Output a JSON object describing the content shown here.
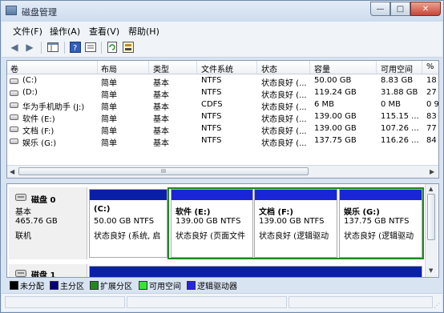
{
  "window": {
    "title": "磁盘管理",
    "min_label": "—",
    "max_label": "□",
    "close_label": "✕"
  },
  "menu": [
    "文件(F)",
    "操作(A)",
    "查看(V)",
    "帮助(H)"
  ],
  "columns": [
    "卷",
    "布局",
    "类型",
    "文件系统",
    "状态",
    "容量",
    "可用空间",
    "%"
  ],
  "volumes": [
    [
      "(C:)",
      "简单",
      "基本",
      "NTFS",
      "状态良好 (...",
      "50.00 GB",
      "8.83 GB",
      "18"
    ],
    [
      "(D:)",
      "简单",
      "基本",
      "NTFS",
      "状态良好 (...",
      "119.24 GB",
      "31.88 GB",
      "27"
    ],
    [
      "华为手机助手 (J:)",
      "简单",
      "基本",
      "CDFS",
      "状态良好 (...",
      "6 MB",
      "0 MB",
      "0 9"
    ],
    [
      "软件 (E:)",
      "简单",
      "基本",
      "NTFS",
      "状态良好 (...",
      "139.00 GB",
      "115.15 ...",
      "83"
    ],
    [
      "文档 (F:)",
      "简单",
      "基本",
      "NTFS",
      "状态良好 (...",
      "139.00 GB",
      "107.26 ...",
      "77"
    ],
    [
      "娱乐 (G:)",
      "简单",
      "基本",
      "NTFS",
      "状态良好 (...",
      "137.75 GB",
      "116.26 ...",
      "84"
    ]
  ],
  "hscroll_grip": "III",
  "disk0": {
    "name": "磁盘 0",
    "type": "基本",
    "size": "465.76 GB",
    "status": "联机",
    "partitions": [
      {
        "name": "(C:)",
        "size": "50.00 GB NTFS",
        "status": "状态良好 (系统, 启"
      },
      {
        "name": "软件  (E:)",
        "size": "139.00 GB NTFS",
        "status": "状态良好 (页面文件"
      },
      {
        "name": "文档  (F:)",
        "size": "139.00 GB NTFS",
        "status": "状态良好 (逻辑驱动"
      },
      {
        "name": "娱乐  (G:)",
        "size": "137.75 GB NTFS",
        "status": "状态良好 (逻辑驱动"
      }
    ]
  },
  "disk1": {
    "name": "磁盘 1"
  },
  "legend": [
    {
      "label": "未分配",
      "color": "#000000"
    },
    {
      "label": "主分区",
      "color": "#000080"
    },
    {
      "label": "扩展分区",
      "color": "#1e8a1e"
    },
    {
      "label": "可用空间",
      "color": "#33e633"
    },
    {
      "label": "逻辑驱动器",
      "color": "#2424e6"
    }
  ],
  "colors": {
    "primary_bar": "#0a1fa8",
    "logical_bar": "#1a25d8",
    "extended_border": "#1e8a1e"
  }
}
